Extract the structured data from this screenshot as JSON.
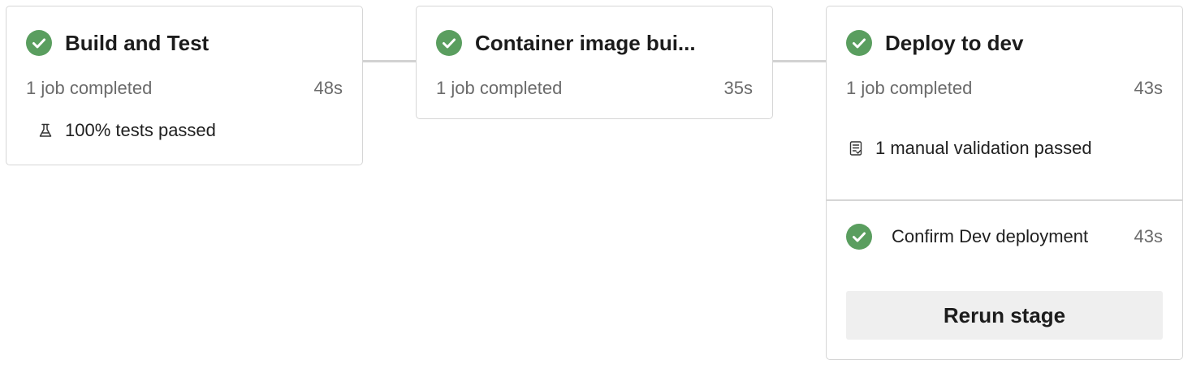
{
  "colors": {
    "success": "#5a9e5f",
    "connector": "#d2d2d2",
    "card_border": "#d6d6d6",
    "button_bg": "#efefef"
  },
  "stages": [
    {
      "title": "Build and Test",
      "status_icon": "check-circle-icon",
      "jobs_summary": "1 job completed",
      "duration": "48s",
      "detail": {
        "icon": "beaker-icon",
        "text": "100% tests passed"
      }
    },
    {
      "title": "Container image bui...",
      "status_icon": "check-circle-icon",
      "jobs_summary": "1 job completed",
      "duration": "35s"
    },
    {
      "title": "Deploy to dev",
      "status_icon": "check-circle-icon",
      "jobs_summary": "1 job completed",
      "duration": "43s",
      "detail": {
        "icon": "checklist-icon",
        "text": "1 manual validation passed"
      },
      "sub_job": {
        "status_icon": "check-circle-icon",
        "label": "Confirm Dev deployment",
        "duration": "43s"
      },
      "rerun_label": "Rerun stage"
    }
  ]
}
